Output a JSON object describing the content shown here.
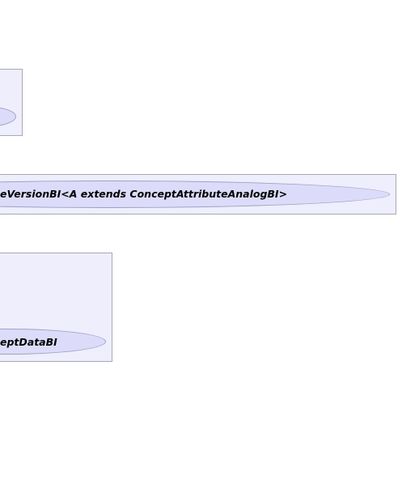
{
  "diagram": {
    "colors": {
      "package_fill": "#eeeefc",
      "package_border": "#a8a8b8",
      "interface_fill": "#dcdcfa",
      "interface_border": "#a0a0c4",
      "text": "#000000"
    },
    "nodes": [
      {
        "id": "top-interface",
        "label": ""
      },
      {
        "id": "version-interface",
        "label": "eVersionBI<A extends ConceptAttributeAnalogBI>"
      },
      {
        "id": "data-interface",
        "label": "eptDataBI"
      }
    ]
  }
}
